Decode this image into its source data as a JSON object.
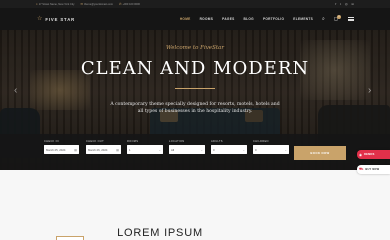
{
  "topbar": {
    "address": "17 Street Name, New York City",
    "email": "theme@yourdomain.com",
    "phone": "+000 100 0000",
    "address_icon": "location-pin-icon",
    "email_icon": "envelope-icon",
    "phone_icon": "phone-icon",
    "social_icons": [
      "facebook-icon",
      "twitter-icon",
      "instagram-icon",
      "linkedin-icon"
    ]
  },
  "header": {
    "brand": "FIVE STAR",
    "logo_icon": "star-icon",
    "menu": [
      "HOME",
      "ROOMS",
      "PAGES",
      "BLOG",
      "PORTFOLIO",
      "ELEMENTS"
    ],
    "active_menu": "HOME",
    "cart_count": "0"
  },
  "hero": {
    "welcome": "Welcome to FiveStar",
    "title": "CLEAN AND MODERN",
    "description": "A contemporary theme specially designed for resorts, motels, hotels and all types of businesses in the hospitality industry.",
    "prev_icon": "chevron-left-icon",
    "next_icon": "chevron-right-icon"
  },
  "booking": {
    "checkin_label": "CHECK IN",
    "checkin_value": "March 25, 2024",
    "checkout_label": "CHECK OUT",
    "checkout_value": "March 26, 2024",
    "rooms_label": "ROOMS",
    "rooms_value": "1",
    "location_label": "LOCATION",
    "location_value": "All",
    "adults_label": "ADULTS",
    "adults_value": "0",
    "children_label": "CHILDREN",
    "children_value": "0",
    "button_label": "BOOK NOW"
  },
  "section": {
    "heading": "LOREM IPSUM"
  },
  "side_buttons": {
    "demos_label": "DEMOS",
    "buy_label": "BUY NOW"
  },
  "colors": {
    "accent": "#c9a36a",
    "dark": "#151515",
    "demo_red": "#e2304a"
  }
}
